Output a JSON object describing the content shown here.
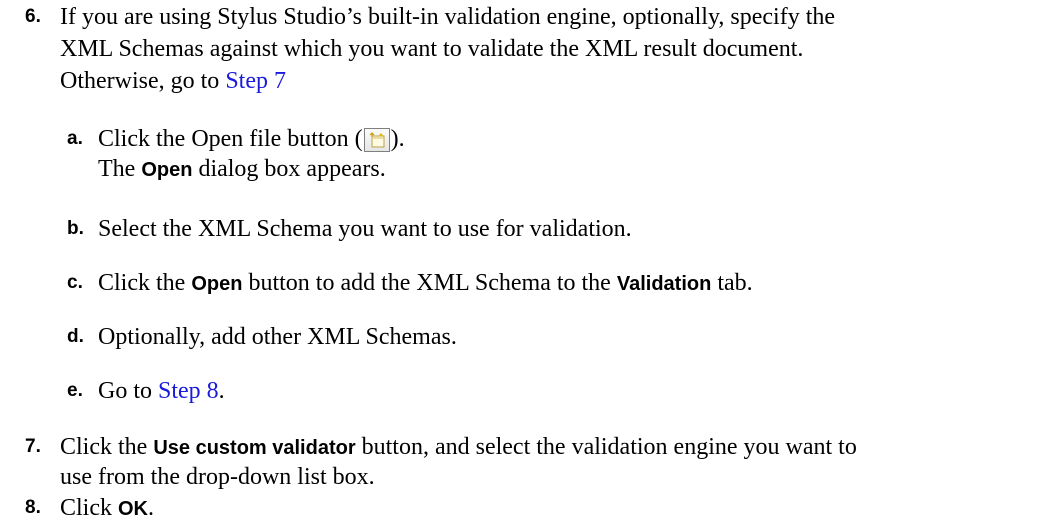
{
  "steps": {
    "s6": {
      "number": "6.",
      "line1": "If you are using Stylus Studio’s built-in validation engine, optionally, specify the",
      "line2": "XML Schemas against which you want to validate the XML result document.",
      "line3_text": "Otherwise, go to ",
      "line3_link": "Step 7"
    },
    "s6a": {
      "label": "a.",
      "text_before": "Click the Open file button (",
      "text_after": ").",
      "line2_bold": "Open",
      "line2_rest": " dialog box appears.",
      "line2_prefix": "The ",
      "icon": "open-file-icon"
    },
    "s6b": {
      "label": "b.",
      "text": "Select the XML Schema you want to use for validation."
    },
    "s6c": {
      "label": "c.",
      "text1": "Click the ",
      "bold1": "Open",
      "text2": " button to add the XML Schema to the ",
      "bold2": "Validation",
      "text3": " tab."
    },
    "s6d": {
      "label": "d.",
      "text": "Optionally, add other XML Schemas."
    },
    "s6e": {
      "label": "e.",
      "text": "Go to ",
      "link": "Step 8",
      "end": "."
    },
    "s7": {
      "number": "7.",
      "text1": "Click the ",
      "bold1": "Use custom validator",
      "text2": " button, and select the validation engine you want to",
      "line2": "use from the drop-down list box."
    },
    "s8": {
      "number": "8.",
      "text1": "Click ",
      "bold1": "OK",
      "text2": "."
    }
  },
  "colors": {
    "link": "#1a1adb",
    "text": "#000000"
  }
}
